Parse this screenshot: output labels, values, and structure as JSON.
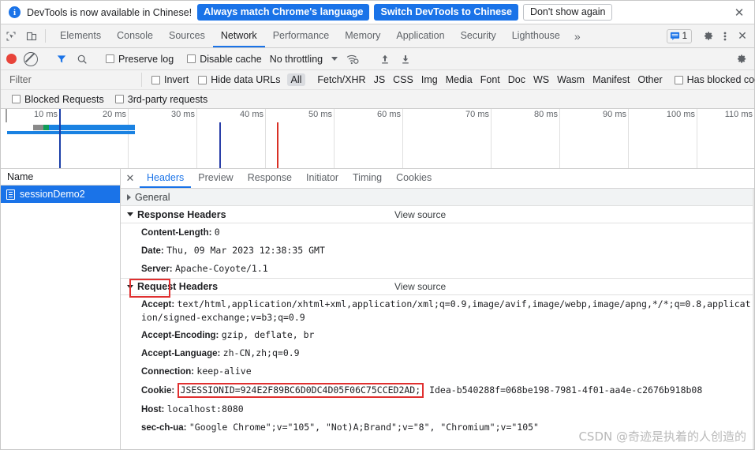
{
  "notification": {
    "icon": "info-icon",
    "message": "DevTools is now available in Chinese!",
    "primary_button": "Always match Chrome's language",
    "secondary_button": "Switch DevTools to Chinese",
    "dismiss_button": "Don't show again",
    "close_icon": "✕"
  },
  "tabstrip": {
    "inspect_icon": "inspect-element-icon",
    "device_icon": "device-toolbar-icon",
    "tabs": [
      {
        "label": "Elements",
        "active": false
      },
      {
        "label": "Console",
        "active": false
      },
      {
        "label": "Sources",
        "active": false
      },
      {
        "label": "Network",
        "active": true
      },
      {
        "label": "Performance",
        "active": false
      },
      {
        "label": "Memory",
        "active": false
      },
      {
        "label": "Application",
        "active": false
      },
      {
        "label": "Security",
        "active": false
      },
      {
        "label": "Lighthouse",
        "active": false
      }
    ],
    "more_tabs": "»",
    "message_count": "1",
    "settings_icon": "gear-icon",
    "more_icon": "kebab-menu-icon",
    "close_icon": "✕"
  },
  "network_toolbar": {
    "record_label": "record-button",
    "clear_label": "clear-button",
    "filter_icon": "funnel-icon",
    "search_icon": "search-icon",
    "preserve_log": "Preserve log",
    "disable_cache": "Disable cache",
    "throttling": "No throttling",
    "wifi_icon": "network-conditions-icon",
    "import_icon": "import-har-icon",
    "export_icon": "export-har-icon",
    "settings_icon": "gear-icon"
  },
  "filter_row": {
    "filter_value": "",
    "filter_placeholder": "Filter",
    "invert": "Invert",
    "hide_data_urls": "Hide data URLs",
    "types": [
      {
        "label": "All",
        "selected": true
      },
      {
        "label": "Fetch/XHR",
        "selected": false
      },
      {
        "label": "JS",
        "selected": false
      },
      {
        "label": "CSS",
        "selected": false
      },
      {
        "label": "Img",
        "selected": false
      },
      {
        "label": "Media",
        "selected": false
      },
      {
        "label": "Font",
        "selected": false
      },
      {
        "label": "Doc",
        "selected": false
      },
      {
        "label": "WS",
        "selected": false
      },
      {
        "label": "Wasm",
        "selected": false
      },
      {
        "label": "Manifest",
        "selected": false
      },
      {
        "label": "Other",
        "selected": false
      }
    ],
    "has_blocked_cookies": "Has blocked cookies"
  },
  "blocked_row": {
    "blocked_requests": "Blocked Requests",
    "third_party_requests": "3rd-party requests"
  },
  "overview": {
    "ticks": [
      "10 ms",
      "20 ms",
      "30 ms",
      "40 ms",
      "50 ms",
      "60 ms",
      "70 ms",
      "80 ms",
      "90 ms",
      "100 ms",
      "110 ms"
    ],
    "bar_color": "#1a82e2",
    "wait_color": "#8a8a8a",
    "download_color": "#0f9d58",
    "dom_content_loaded_color": "#1a3ea8",
    "load_event_color": "#d93025"
  },
  "sidebar": {
    "column_header": "Name",
    "requests": [
      {
        "name": "sessionDemo2",
        "icon": "document-icon",
        "selected": true
      }
    ]
  },
  "detail": {
    "close_icon": "✕",
    "tabs": [
      {
        "label": "Headers",
        "active": true
      },
      {
        "label": "Preview",
        "active": false
      },
      {
        "label": "Response",
        "active": false
      },
      {
        "label": "Initiator",
        "active": false
      },
      {
        "label": "Timing",
        "active": false
      },
      {
        "label": "Cookies",
        "active": false
      }
    ],
    "sections": [
      {
        "title": "General",
        "collapsed": true,
        "view_source": ""
      },
      {
        "title": "Response Headers",
        "collapsed": false,
        "view_source": "View source",
        "headers": [
          {
            "name": "Content-Length:",
            "value": "0"
          },
          {
            "name": "Date:",
            "value": "Thu, 09 Mar 2023 12:38:35 GMT"
          },
          {
            "name": "Server:",
            "value": "Apache-Coyote/1.1"
          }
        ]
      },
      {
        "title": "Request Headers",
        "collapsed": false,
        "view_source": "View source",
        "headers": [
          {
            "name": "Accept:",
            "value": "text/html,application/xhtml+xml,application/xml;q=0.9,image/avif,image/webp,image/apng,*/*;q=0.8,application/signed-exchange;v=b3;q=0.9"
          },
          {
            "name": "Accept-Encoding:",
            "value": "gzip, deflate, br"
          },
          {
            "name": "Accept-Language:",
            "value": "zh-CN,zh;q=0.9"
          },
          {
            "name": "Connection:",
            "value": "keep-alive"
          },
          {
            "name": "Cookie:",
            "value_highlighted": "JSESSIONID=924E2F89BC6D0DC4D05F06C75CCED2AD;",
            "value": " Idea-b540288f=068be198-7981-4f01-aa4e-c2676b918b08"
          },
          {
            "name": "Host:",
            "value": "localhost:8080"
          },
          {
            "name": "sec-ch-ua:",
            "value": "\"Google Chrome\";v=\"105\", \"Not)A;Brand\";v=\"8\", \"Chromium\";v=\"105\""
          }
        ]
      }
    ]
  },
  "annotations": {
    "request_headers_box": "Request",
    "cookie_box": "JSESSIONID=924E2F89BC6D0DC4D05F06C75CCED2AD;"
  },
  "watermark": "CSDN @奇迹是执着的人创造的"
}
